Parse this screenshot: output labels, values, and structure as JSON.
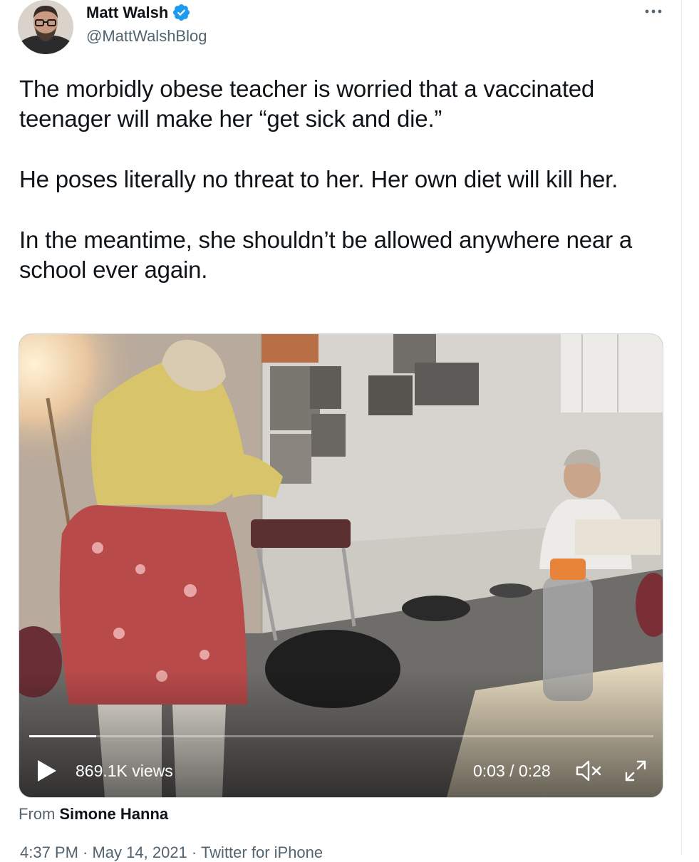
{
  "author": {
    "display_name": "Matt Walsh",
    "handle": "@MattWalshBlog",
    "verified_icon": "verified-badge-icon",
    "avatar_icon": "avatar-photo"
  },
  "more_icon": "more-options-icon",
  "tweet": {
    "paragraphs": [
      "The morbidly obese teacher is worried that a vaccinated teenager will make her “get sick and die.”",
      "He poses literally no threat to her. Her own diet will kill her.",
      "In the meantime, she shouldn’t be allowed anywhere near a school ever again."
    ]
  },
  "media": {
    "views": "869.1K views",
    "time": "0:03 / 0:28",
    "progress": 0.107,
    "play_icon": "play-icon",
    "mute_icon": "muted-speaker-icon",
    "expand_icon": "fullscreen-icon"
  },
  "attribution": {
    "prefix": "From",
    "name": "Simone Hanna"
  },
  "meta_line": "4:37 PM · May 14, 2021 · Twitter for iPhone",
  "colors": {
    "text": "#0f1419",
    "secondary": "#536471",
    "verified": "#1d9bf0",
    "border": "#cfd9de"
  }
}
